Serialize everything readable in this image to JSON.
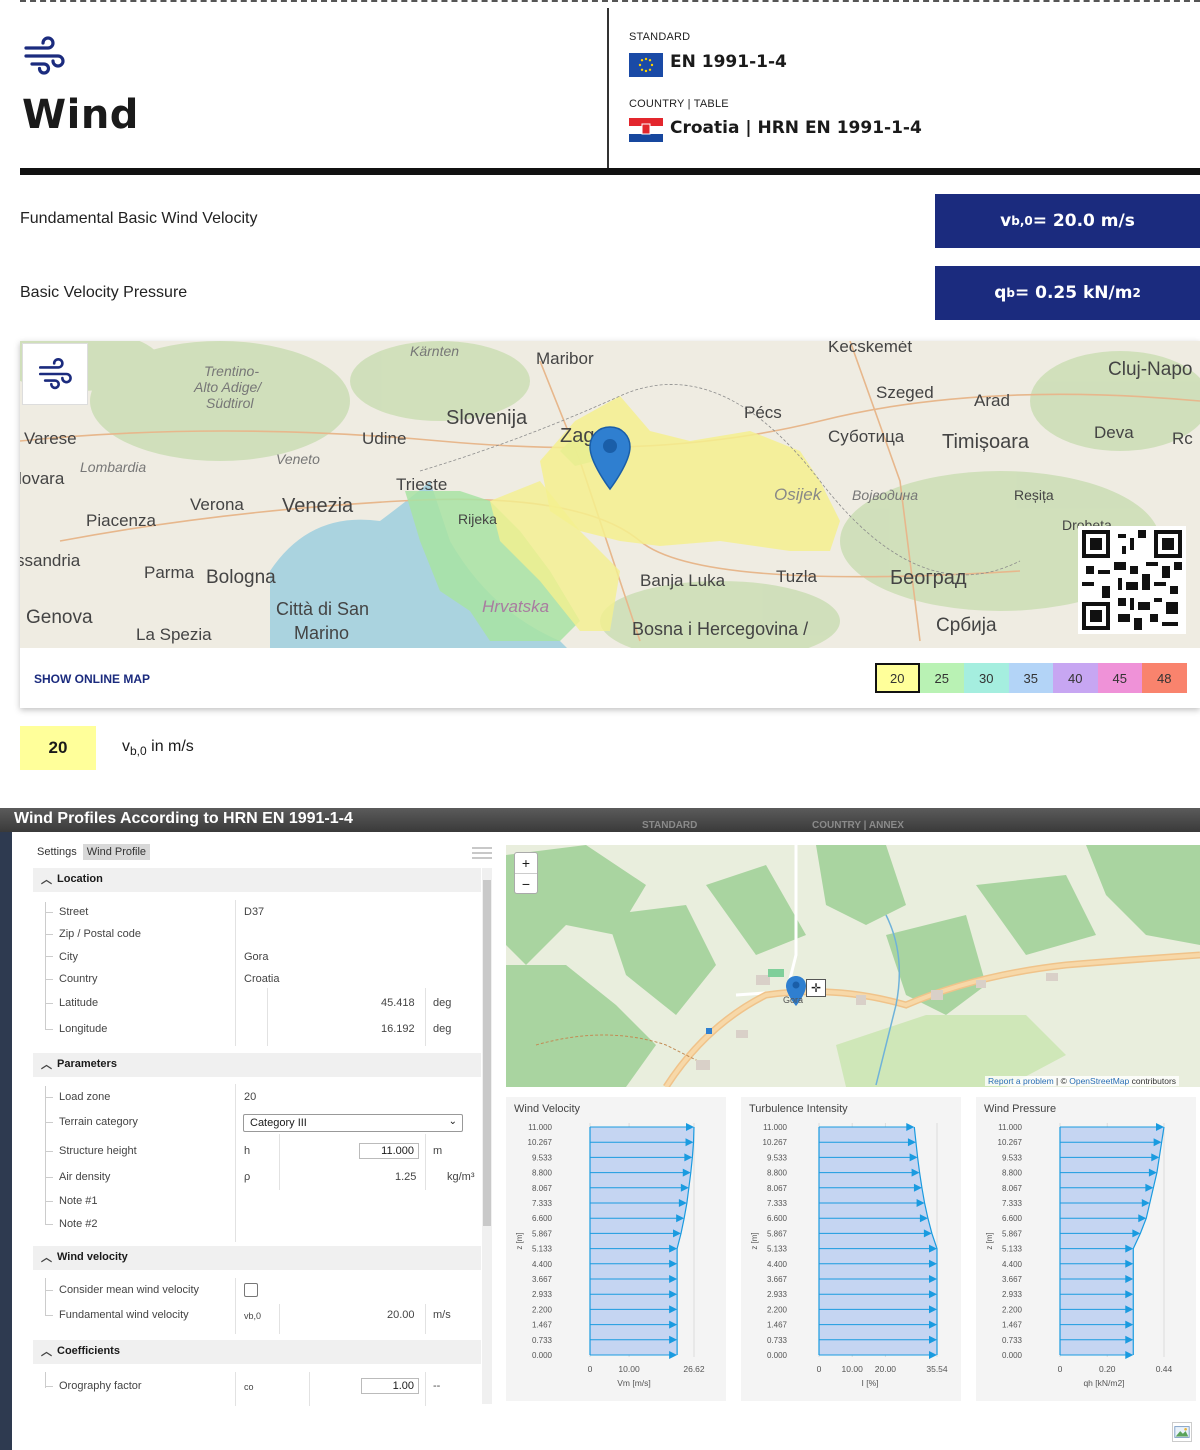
{
  "header": {
    "title": "Wind",
    "standard_label": "STANDARD",
    "standard_value": "EN 1991-1-4",
    "country_label": "COUNTRY | TABLE",
    "country_value": "Croatia | HRN EN 1991-1-4",
    "icons": [
      "wind-icon",
      "eu-flag-icon",
      "croatia-flag-icon"
    ]
  },
  "results": {
    "vb0_label": "Fundamental Basic Wind Velocity",
    "vb0_symbol": "v",
    "vb0_sub": "b,0",
    "vb0_value": " = 20.0 m/s",
    "qb_label": "Basic Velocity Pressure",
    "qb_symbol": "q",
    "qb_sub": "b",
    "qb_value": " = 0.25 kN/m",
    "qb_sup": "2"
  },
  "zone_map": {
    "show_online_map": "SHOW ONLINE MAP",
    "labels": [
      "Kärnten",
      "Maribor",
      "Kecskemét",
      "Cluj-Napo",
      "Trentino-",
      "Alto Adige/",
      "Südtirol",
      "Szeged",
      "Arad",
      "Slovenija",
      "Pécs",
      "Varese",
      "Udine",
      "Zag",
      "Суботица",
      "Timișoara",
      "Deva",
      "Rc",
      "Lombardia",
      "Veneto",
      "lovara",
      "Trieste",
      "Osijek",
      "Војводина",
      "Reșița",
      "Verona",
      "Venezia",
      "Piacenza",
      "Rijeka",
      "Drobeta",
      "ssandria",
      "Parma",
      "Bologna",
      "Banja Luka",
      "Tuzla",
      "Београд",
      "Genova",
      "Città di San",
      "Hrvatska",
      "La Spezia",
      "Marino",
      "Bosna i Hercegovina /",
      "Србија"
    ],
    "legend": [
      "20",
      "25",
      "30",
      "35",
      "40",
      "45",
      "48"
    ],
    "legend_colors": [
      "#ffff9a",
      "#b9f2b4",
      "#a5eedf",
      "#b3d4f7",
      "#c7a6f2",
      "#ef92d8",
      "#f9836d"
    ],
    "selected_zone": "20"
  },
  "key": {
    "value": "20",
    "symbol": "v",
    "sub": "b,0",
    "unit": " in m/s"
  },
  "app": {
    "title": "Wind Profiles According to HRN EN 1991-1-4",
    "ghost_labels": [
      "STANDARD",
      "COUNTRY | ANNEX"
    ],
    "tabs": [
      "Settings",
      "Wind Profile"
    ],
    "active_tab": "Wind Profile",
    "location": {
      "section": "Location",
      "street_label": "Street",
      "street": "D37",
      "zip_label": "Zip / Postal code",
      "zip": "",
      "city_label": "City",
      "city": "Gora",
      "country_label": "Country",
      "country": "Croatia",
      "lat_label": "Latitude",
      "lat": "45.418",
      "lat_unit": "deg",
      "lon_label": "Longitude",
      "lon": "16.192",
      "lon_unit": "deg"
    },
    "parameters": {
      "section": "Parameters",
      "load_zone_label": "Load zone",
      "load_zone": "20",
      "terrain_label": "Terrain category",
      "terrain": "Category III",
      "height_label": "Structure height",
      "height_sym": "h",
      "height": "11.000",
      "height_unit": "m",
      "density_label": "Air density",
      "density_sym": "ρ",
      "density": "1.25",
      "density_unit": "kg/m³",
      "note1": "Note #1",
      "note2": "Note #2"
    },
    "wind_velocity": {
      "section": "Wind velocity",
      "consider_label": "Consider mean wind velocity",
      "consider_checked": false,
      "fundamental_label": "Fundamental wind velocity",
      "fundamental_sym": "vb,0",
      "fundamental": "20.00",
      "fundamental_unit": "m/s"
    },
    "coefficients": {
      "section": "Coefficients",
      "orography_label": "Orography factor",
      "orography_sym": "co",
      "orography": "1.00",
      "orography_unit": "--"
    },
    "detail_map": {
      "place": "Gora",
      "attribution_link1": "Report a problem",
      "attribution_sep": " | © ",
      "attribution_link2": "OpenStreetMap",
      "attribution_tail": " contributors",
      "zoom_in": "+",
      "zoom_out": "−"
    }
  },
  "chart_data": [
    {
      "type": "area",
      "title": "Wind Velocity",
      "xlabel": "Vm [m/s]",
      "ylabel": "z [m]",
      "xlim": [
        0,
        26.62
      ],
      "x_ticks": [
        "0",
        "10.00",
        "26.62"
      ],
      "y": [
        0.0,
        0.733,
        1.467,
        2.2,
        2.933,
        3.667,
        4.4,
        5.133,
        5.867,
        6.6,
        7.333,
        8.067,
        8.8,
        9.533,
        10.267,
        11.0
      ],
      "x": [
        22.3,
        22.3,
        22.3,
        22.3,
        22.3,
        22.3,
        22.3,
        22.3,
        23.3,
        24.1,
        24.8,
        25.3,
        25.8,
        26.2,
        26.5,
        26.62
      ]
    },
    {
      "type": "area",
      "title": "Turbulence Intensity",
      "xlabel": "I [%]",
      "ylabel": "z [m]",
      "xlim": [
        0,
        35.54
      ],
      "x_ticks": [
        "0",
        "10.00",
        "20.00",
        "35.54"
      ],
      "y": [
        0.0,
        0.733,
        1.467,
        2.2,
        2.933,
        3.667,
        4.4,
        5.133,
        5.867,
        6.6,
        7.333,
        8.067,
        8.8,
        9.533,
        10.267,
        11.0
      ],
      "x": [
        35.54,
        35.54,
        35.54,
        35.54,
        35.54,
        35.54,
        35.54,
        35.54,
        34.0,
        32.8,
        31.8,
        31.0,
        30.3,
        29.7,
        29.2,
        28.7
      ]
    },
    {
      "type": "area",
      "title": "Wind Pressure",
      "xlabel": "qh [kN/m2]",
      "ylabel": "z [m]",
      "xlim": [
        0,
        0.44
      ],
      "x_ticks": [
        "0",
        "0.20",
        "0.44"
      ],
      "y": [
        0.0,
        0.733,
        1.467,
        2.2,
        2.933,
        3.667,
        4.4,
        5.133,
        5.867,
        6.6,
        7.333,
        8.067,
        8.8,
        9.533,
        10.267,
        11.0
      ],
      "x": [
        0.31,
        0.31,
        0.31,
        0.31,
        0.31,
        0.31,
        0.31,
        0.31,
        0.34,
        0.365,
        0.38,
        0.395,
        0.41,
        0.42,
        0.43,
        0.44
      ]
    }
  ]
}
